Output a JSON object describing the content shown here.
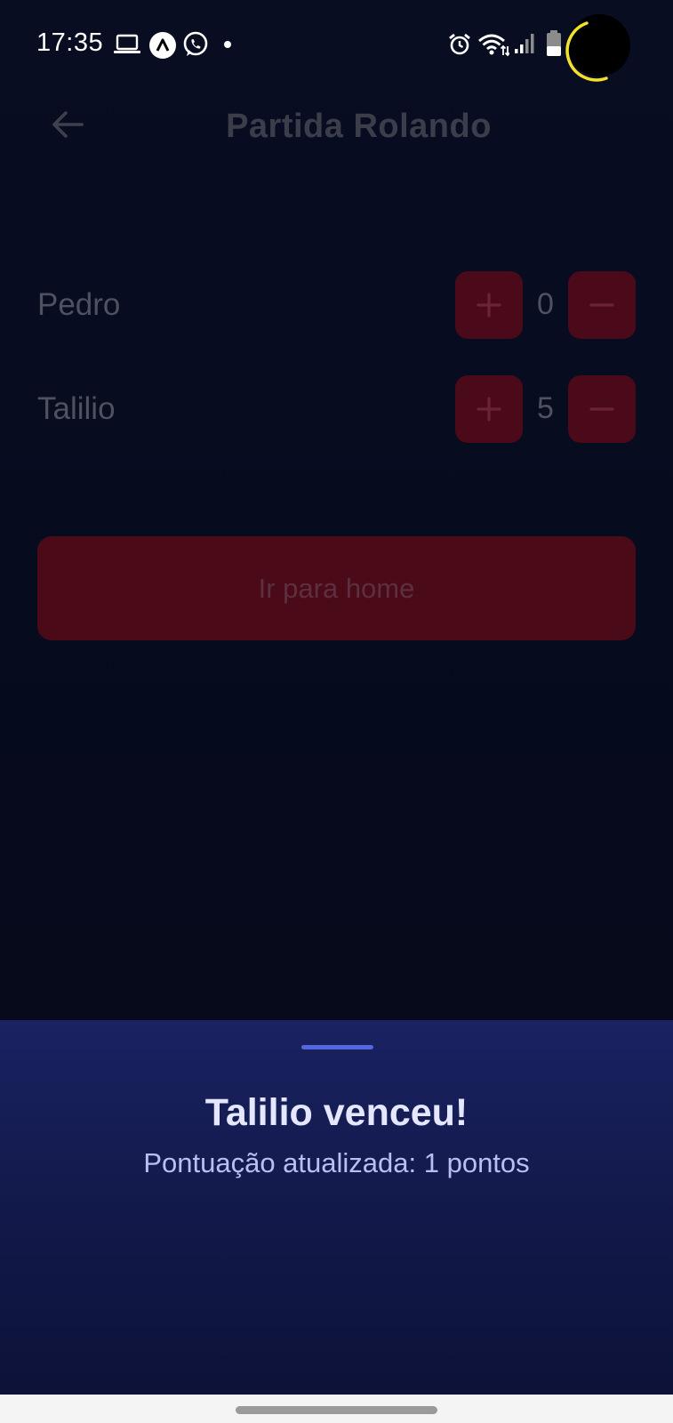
{
  "status_bar": {
    "time": "17:35",
    "left_icons": [
      "laptop-icon",
      "app-a-icon",
      "whatsapp-icon",
      "dot-icon"
    ],
    "right_icons": [
      "alarm-icon",
      "wifi-icon",
      "signal-icon",
      "battery-icon"
    ]
  },
  "header": {
    "title": "Partida Rolando",
    "back_icon": "arrow-left-icon"
  },
  "players": [
    {
      "name": "Pedro",
      "score": "0"
    },
    {
      "name": "Talilio",
      "score": "5"
    }
  ],
  "actions": {
    "home_label": "Ir para home"
  },
  "result_sheet": {
    "title": "Talilio venceu!",
    "subtitle": "Pontuação atualizada: 1 pontos"
  },
  "colors": {
    "background": "#070b1d",
    "button": "#4a0a1a",
    "sheet": "#1a2262",
    "accent": "#5466e0"
  }
}
